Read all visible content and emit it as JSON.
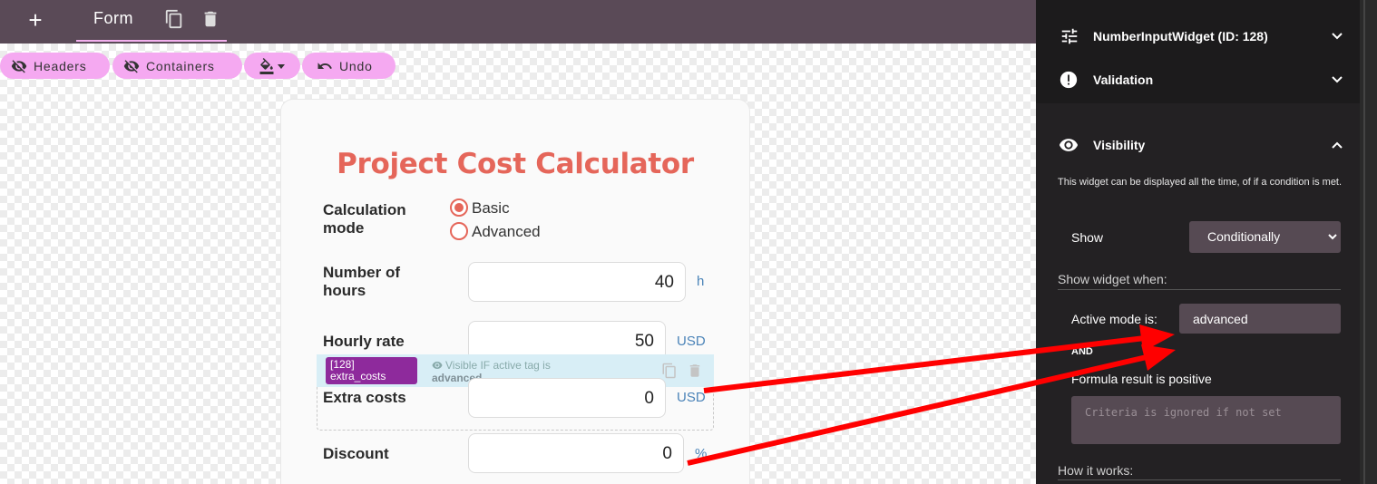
{
  "topbar": {
    "tab_label": "Form"
  },
  "toolbar": {
    "headers_label": "Headers",
    "containers_label": "Containers",
    "undo_label": "Undo"
  },
  "form": {
    "title": "Project Cost Calculator",
    "calc_mode_label": "Calculation mode",
    "mode_options": [
      "Basic",
      "Advanced"
    ],
    "mode_selected": "Basic",
    "hours_label": "Number of hours",
    "hours_value": "40",
    "hours_unit": "h",
    "rate_label": "Hourly rate",
    "rate_value": "50",
    "rate_unit": "USD",
    "extra_label": "Extra costs",
    "extra_value": "0",
    "extra_unit": "USD",
    "discount_label": "Discount",
    "discount_value": "0",
    "discount_unit": "%"
  },
  "selected_widget": {
    "id_tag": "[128]",
    "name": "extra_costs",
    "visibility_note": "Visible IF active tag is",
    "visibility_value": "advanced"
  },
  "panel": {
    "widget_header": "NumberInputWidget (ID: 128)",
    "validation_header": "Validation",
    "visibility_header": "Visibility",
    "visibility_desc": "This widget can be displayed all the time, of if a condition is met.",
    "show_label": "Show",
    "show_value": "Conditionally",
    "show_when_label": "Show widget when:",
    "active_mode_label": "Active mode is:",
    "active_mode_value": "advanced",
    "and_label": "AND",
    "formula_label": "Formula result is positive",
    "criteria_placeholder": "Criteria is ignored if not set",
    "how_it_works_label": "How it works:"
  },
  "colors": {
    "topbar": "#5a4a57",
    "pill": "#f5a9f1",
    "accent": "#e5665a",
    "badge": "#8e2a9c",
    "panel": "#232123",
    "arrow": "#ff0000"
  }
}
